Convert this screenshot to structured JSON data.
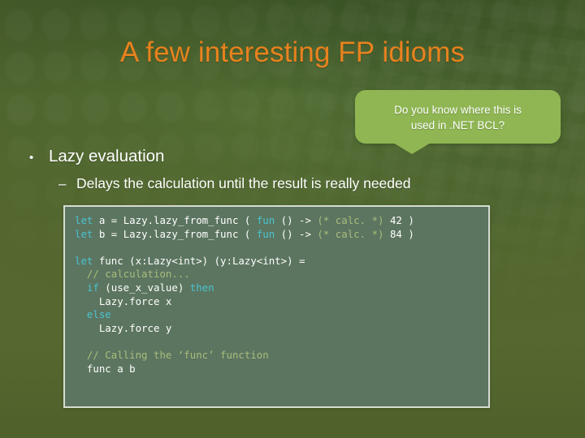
{
  "slide": {
    "title": "A few interesting FP idioms",
    "title_color": "#e8821e",
    "background_color": "#53662f"
  },
  "callout": {
    "line1": "Do you know where this is",
    "line2": "used in .NET BCL?",
    "background_color": "#8fb653",
    "text_color": "#ffffff"
  },
  "bullets": {
    "level1": {
      "marker": "•",
      "text": "Lazy evaluation"
    },
    "level2": {
      "marker": "–",
      "text": "Delays the calculation until the result is really needed"
    }
  },
  "code": {
    "background_color": "#5c7560",
    "border_color": "#d7dcd2",
    "keyword_color": "#49c4d2",
    "comment_color": "#a9bd7c",
    "text_color": "#ffffff",
    "lines": [
      {
        "id": "l01",
        "segments": [
          {
            "t": "let",
            "c": "kw"
          },
          {
            "t": " a = Lazy.lazy_from_func ( ",
            "c": ""
          },
          {
            "t": "fun",
            "c": "kw"
          },
          {
            "t": " () -> ",
            "c": ""
          },
          {
            "t": "(* calc. *)",
            "c": "cm"
          },
          {
            "t": " 42 )",
            "c": ""
          }
        ]
      },
      {
        "id": "l02",
        "segments": [
          {
            "t": "let",
            "c": "kw"
          },
          {
            "t": " b = Lazy.lazy_from_func ( ",
            "c": ""
          },
          {
            "t": "fun",
            "c": "kw"
          },
          {
            "t": " () -> ",
            "c": ""
          },
          {
            "t": "(* calc. *)",
            "c": "cm"
          },
          {
            "t": " 84 )",
            "c": ""
          }
        ]
      },
      {
        "id": "l03",
        "segments": []
      },
      {
        "id": "l04",
        "segments": [
          {
            "t": "let",
            "c": "kw"
          },
          {
            "t": " func (x:Lazy<int>) (y:Lazy<int>) =",
            "c": ""
          }
        ]
      },
      {
        "id": "l05",
        "segments": [
          {
            "t": "  ",
            "c": ""
          },
          {
            "t": "// calculation...",
            "c": "cm"
          }
        ]
      },
      {
        "id": "l06",
        "segments": [
          {
            "t": "  ",
            "c": ""
          },
          {
            "t": "if",
            "c": "kw"
          },
          {
            "t": " (use_x_value) ",
            "c": ""
          },
          {
            "t": "then",
            "c": "kw"
          }
        ]
      },
      {
        "id": "l07",
        "segments": [
          {
            "t": "    Lazy.force x",
            "c": ""
          }
        ]
      },
      {
        "id": "l08",
        "segments": [
          {
            "t": "  ",
            "c": ""
          },
          {
            "t": "else",
            "c": "kw"
          }
        ]
      },
      {
        "id": "l09",
        "segments": [
          {
            "t": "    Lazy.force y",
            "c": ""
          }
        ]
      },
      {
        "id": "l10",
        "segments": []
      },
      {
        "id": "l11",
        "segments": [
          {
            "t": "  ",
            "c": ""
          },
          {
            "t": "// Calling the ‘func’ function",
            "c": "cm"
          }
        ]
      },
      {
        "id": "l12",
        "segments": [
          {
            "t": "  func a b",
            "c": ""
          }
        ]
      }
    ]
  }
}
